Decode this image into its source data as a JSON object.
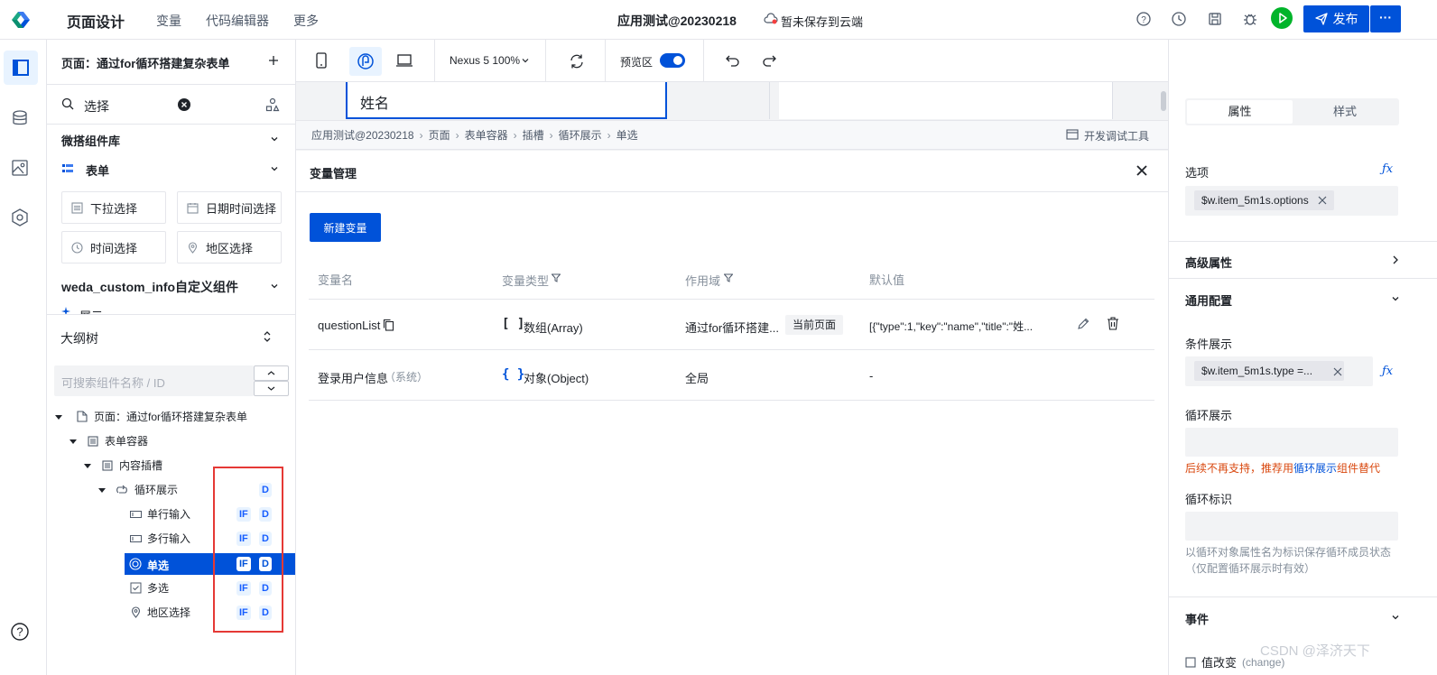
{
  "topbar": {
    "title": "页面设计",
    "menu": [
      "变量",
      "代码编辑器",
      "更多"
    ],
    "app_name": "应用测试@20230218",
    "save_status": "暂未保存到云端",
    "publish_label": "发布",
    "more_label": "···"
  },
  "left": {
    "page_selector": "页面：通过for循环搭建复杂表单",
    "search_value": "选择",
    "section_lib": "微搭组件库",
    "section_form": "表单",
    "components": [
      "下拉选择",
      "日期时间选择",
      "时间选择",
      "地区选择"
    ],
    "section_custom": "weda_custom_info自定义组件",
    "partial_item": "展示",
    "outline_title": "大纲树",
    "outline_search_placeholder": "可搜索组件名称 / ID",
    "tree": [
      {
        "label": "页面：通过for循环搭建复杂表单",
        "tags": []
      },
      {
        "label": "表单容器",
        "tags": []
      },
      {
        "label": "内容插槽",
        "tags": []
      },
      {
        "label": "循环展示",
        "tags": [
          "D"
        ]
      },
      {
        "label": "单行输入",
        "tags": [
          "IF",
          "D"
        ]
      },
      {
        "label": "多行输入",
        "tags": [
          "IF",
          "D"
        ]
      },
      {
        "label": "单选",
        "tags": [
          "IF",
          "D"
        ]
      },
      {
        "label": "多选",
        "tags": [
          "IF",
          "D"
        ]
      },
      {
        "label": "地区选择",
        "tags": [
          "IF",
          "D"
        ]
      }
    ]
  },
  "center": {
    "device": "Nexus 5 100%",
    "preview_label": "预览区",
    "canvas_field": "姓名",
    "breadcrumb": [
      "应用测试@20230218",
      "页面",
      "表单容器",
      "插槽",
      "循环展示",
      "单选"
    ],
    "devtools": "开发调试工具",
    "modal": {
      "title": "变量管理",
      "new_button": "新建变量",
      "headers": [
        "变量名",
        "变量类型",
        "作用域",
        "默认值"
      ],
      "rows": [
        {
          "name": "questionList",
          "type_icon": "[ ]",
          "type": "数组(Array)",
          "scope": "通过for循环搭建...",
          "scope_tag": "当前页面",
          "default": "[{\"type\":1,\"key\":\"name\",\"title\":\"姓..."
        },
        {
          "name": "登录用户信息",
          "name_note": "（系统）",
          "type_icon": "{ }",
          "type": "对象(Object)",
          "scope": "全局",
          "scope_tag": "",
          "default": "-"
        }
      ]
    }
  },
  "right": {
    "tabs": [
      "属性",
      "样式"
    ],
    "options_label": "选项",
    "options_value": "$w.item_5m1s.options",
    "advanced": "高级属性",
    "general": "通用配置",
    "cond_label": "条件展示",
    "cond_value": "$w.item_5m1s.type =...",
    "loop_label": "循环展示",
    "loop_warning_prefix": "后续不再支持，推荐用",
    "loop_warning_link": "循环展示",
    "loop_warning_suffix": "组件替代",
    "loop_id_label": "循环标识",
    "loop_id_hint": "以循环对象属性名为标识保存循环成员状态（仅配置循环展示时有效）",
    "events": "事件",
    "event_item": "值改变",
    "event_item_note": "(change)"
  },
  "watermark": "CSDN @泽济天下",
  "colors": {
    "primary": "#0052d9",
    "highlight_box": "#e53935",
    "warning": "#d9480f"
  }
}
